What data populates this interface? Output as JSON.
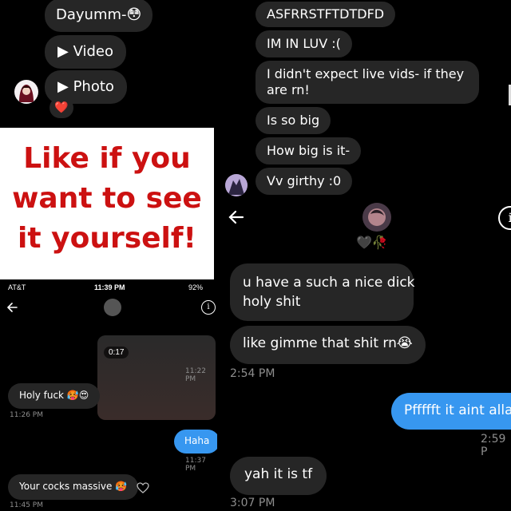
{
  "colors": {
    "bubble": "#262626",
    "own_bubble": "#3797f0",
    "banner_text": "#cc1111",
    "timestamp": "#8e8e8e"
  },
  "panel_top_left": {
    "messages": [
      "Dayumm-😳",
      "▶ Video",
      "▶ Photo"
    ],
    "reaction": "❤️"
  },
  "banner": {
    "lines": [
      "Like if you",
      "want to see",
      "it yourself!"
    ]
  },
  "panel_top_right": {
    "messages": [
      "ASFRRSTFTDTDFD",
      "IM IN LUV :(",
      "I didn't expect live vids- if they",
      "are rn!",
      "Is so big",
      "How big is it-",
      "Vv girthy :0"
    ]
  },
  "panel_bottom_left": {
    "status": {
      "carrier": "AT&T",
      "time": "11:39 PM",
      "battery": "92%"
    },
    "video": {
      "duration": "0:17"
    },
    "items": [
      {
        "kind": "time",
        "text": "11:22 PM"
      },
      {
        "kind": "msg",
        "text": "Holy fuck 🥵😍"
      },
      {
        "kind": "time",
        "text": "11:26 PM"
      },
      {
        "kind": "own",
        "text": "Haha"
      },
      {
        "kind": "time",
        "text": "11:37 PM"
      },
      {
        "kind": "msg",
        "text": "Your cocks massive 🥵"
      },
      {
        "kind": "time",
        "text": "11:45 PM"
      }
    ]
  },
  "panel_bottom_right": {
    "profile_emojis": "🖤🥀",
    "messages": [
      "u have a such a nice dick",
      "holy shit",
      "like gimme that shit rn😭"
    ],
    "time1": "2:54 PM",
    "own": "Pffffft it aint allat",
    "time2": "2:59 P",
    "reply": "yah it is tf",
    "time3": "3:07 PM"
  }
}
